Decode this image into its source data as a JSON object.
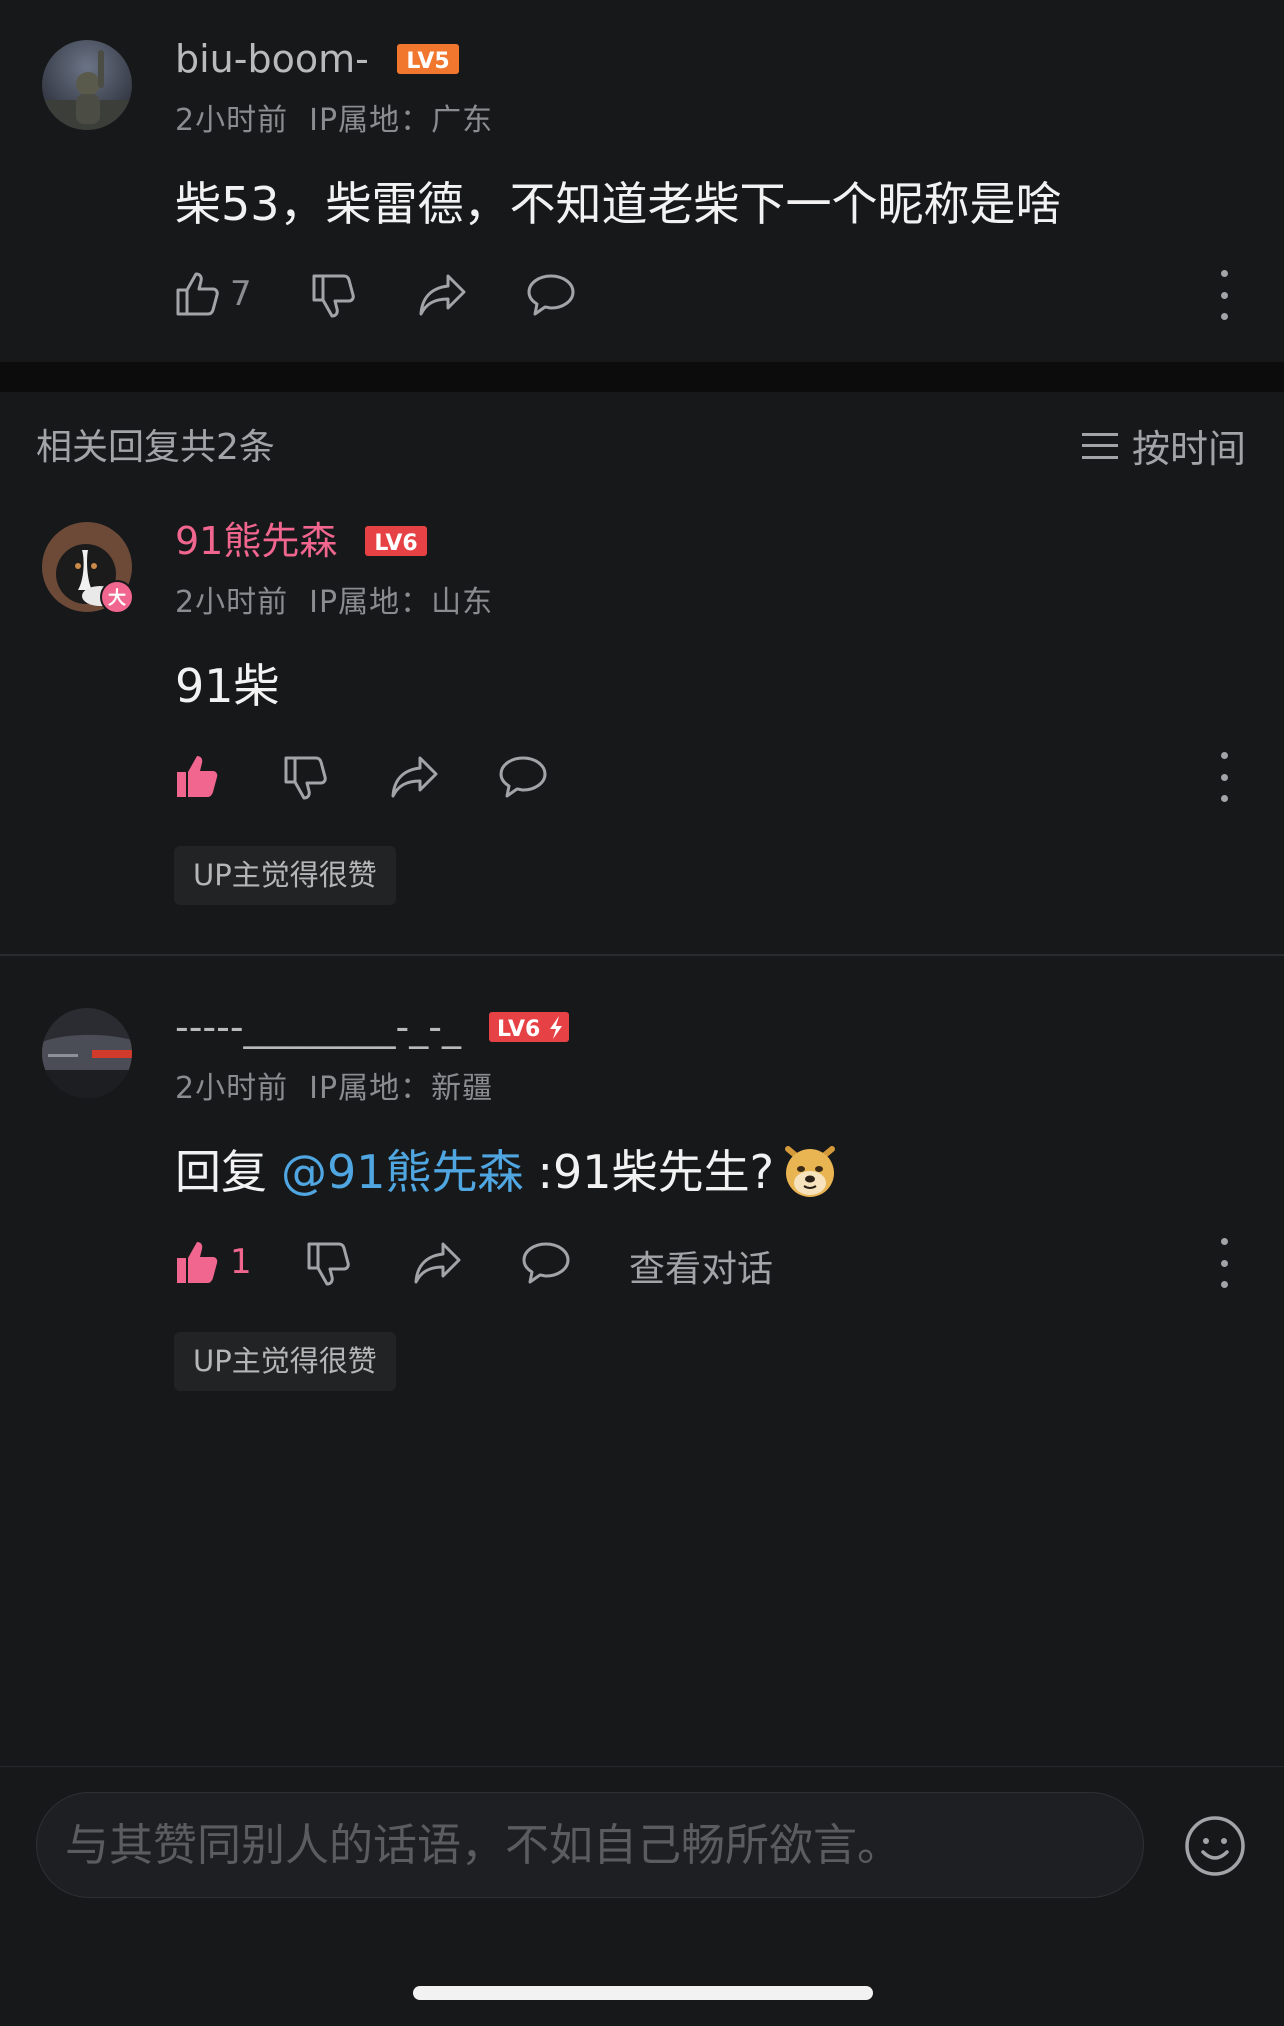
{
  "main_comment": {
    "username": "biu-boom-",
    "level": "LV5",
    "time": "2小时前",
    "ip": "IP属地：广东",
    "content": "柴53，柴雷德，不知道老柴下一个昵称是啥",
    "like_count": "7"
  },
  "replies_header": {
    "title": "相关回复共2条",
    "sort_label": "按时间"
  },
  "replies": [
    {
      "username": "91熊先森",
      "level": "LV6",
      "avatar_badge": "大",
      "time": "2小时前",
      "ip": "IP属地：山东",
      "content": "91柴",
      "up_tag": "UP主觉得很赞"
    },
    {
      "username": "-----________-_-_",
      "level": "LV6",
      "time": "2小时前",
      "ip": "IP属地：新疆",
      "reply_prefix": "回复",
      "mention": "@91熊先森",
      "content": ":91柴先生?",
      "like_count": "1",
      "view_conversation": "查看对话",
      "up_tag": "UP主觉得很赞"
    }
  ],
  "composer": {
    "placeholder": "与其赞同别人的话语，不如自己畅所欲言。"
  },
  "colors": {
    "background": "#17181a",
    "accent_pink": "#f0668f",
    "mention_blue": "#4fa6e0",
    "lv5_orange": "#f0772d",
    "lv6_red": "#e64245"
  }
}
